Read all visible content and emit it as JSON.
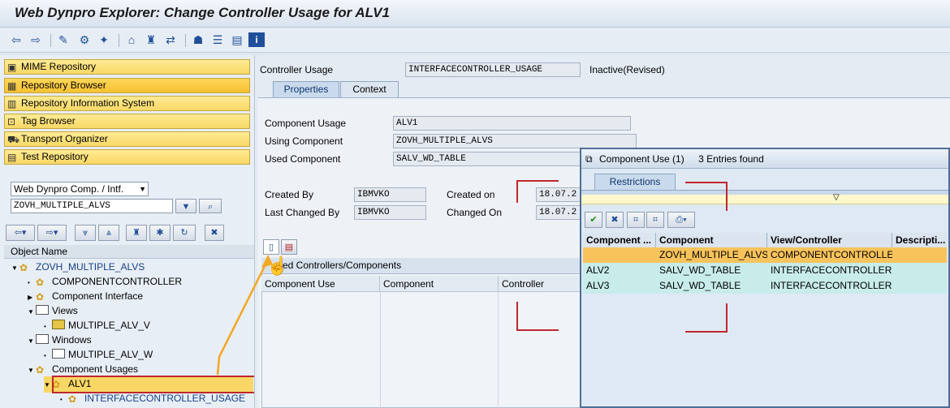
{
  "window": {
    "title": "Web Dynpro Explorer: Change Controller Usage for ALV1"
  },
  "toolbar": {
    "icons": [
      "back-icon",
      "forward-icon",
      "other-object-icon",
      "display-change-icon",
      "active-inactive-icon",
      "where-used-icon",
      "object-list-icon",
      "navigate-icon",
      "layout-icon",
      "info-icon"
    ]
  },
  "nav": {
    "items": [
      {
        "label": "MIME Repository"
      },
      {
        "label": "Repository Browser"
      },
      {
        "label": "Repository Information System"
      },
      {
        "label": "Tag Browser"
      },
      {
        "label": "Transport Organizer"
      },
      {
        "label": "Test Repository"
      }
    ],
    "type_select": "Web Dynpro Comp. / Intf.",
    "object_value": "ZOVH_MULTIPLE_ALVS"
  },
  "tree": {
    "header": "Object Name",
    "nodes": [
      {
        "label": "ZOVH_MULTIPLE_ALVS"
      },
      {
        "label": "COMPONENTCONTROLLER"
      },
      {
        "label": "Component Interface"
      },
      {
        "label": "Views"
      },
      {
        "label": "MULTIPLE_ALV_V"
      },
      {
        "label": "Windows"
      },
      {
        "label": "MULTIPLE_ALV_W"
      },
      {
        "label": "Component Usages"
      },
      {
        "label": "ALV1"
      },
      {
        "label": "INTERFACECONTROLLER_USAGE"
      }
    ]
  },
  "main": {
    "controller_usage_label": "Controller Usage",
    "controller_usage_value": "INTERFACECONTROLLER_USAGE",
    "status": "Inactive(Revised)",
    "tabs": [
      {
        "label": "Properties"
      },
      {
        "label": "Context"
      }
    ],
    "component_usage_label": "Component Usage",
    "component_usage_value": "ALV1",
    "using_component_label": "Using Component",
    "using_component_value": "ZOVH_MULTIPLE_ALVS",
    "used_component_label": "Used Component",
    "used_component_value": "SALV_WD_TABLE",
    "created_by_label": "Created By",
    "created_by_value": "IBMVKO",
    "created_on_label": "Created on",
    "created_on_value": "18.07.2",
    "last_changed_by_label": "Last Changed By",
    "last_changed_by_value": "IBMVKO",
    "changed_on_label": "Changed On",
    "changed_on_value": "18.07.2",
    "used_controllers_title": "sed Controllers/Components",
    "used_columns": [
      "Component Use",
      "Component",
      "Controller"
    ]
  },
  "dialog": {
    "title": "Component Use (1)",
    "entries_found": "3 Entries found",
    "tab": "Restrictions",
    "columns": [
      "Component ...",
      "Component",
      "View/Controller",
      "Descripti..."
    ],
    "rows": [
      [
        "",
        "ZOVH_MULTIPLE_ALVS",
        "COMPONENTCONTROLLER",
        ""
      ],
      [
        "ALV2",
        "SALV_WD_TABLE",
        "INTERFACECONTROLLER",
        ""
      ],
      [
        "ALV3",
        "SALV_WD_TABLE",
        "INTERFACECONTROLLER",
        ""
      ]
    ]
  },
  "colors": {
    "highlight_row": "#f8c35a",
    "cyan_row": "#c7ecea",
    "nav_button": "#ffe27f",
    "annotation": "#c0272d",
    "arrow": "#f5a623"
  }
}
